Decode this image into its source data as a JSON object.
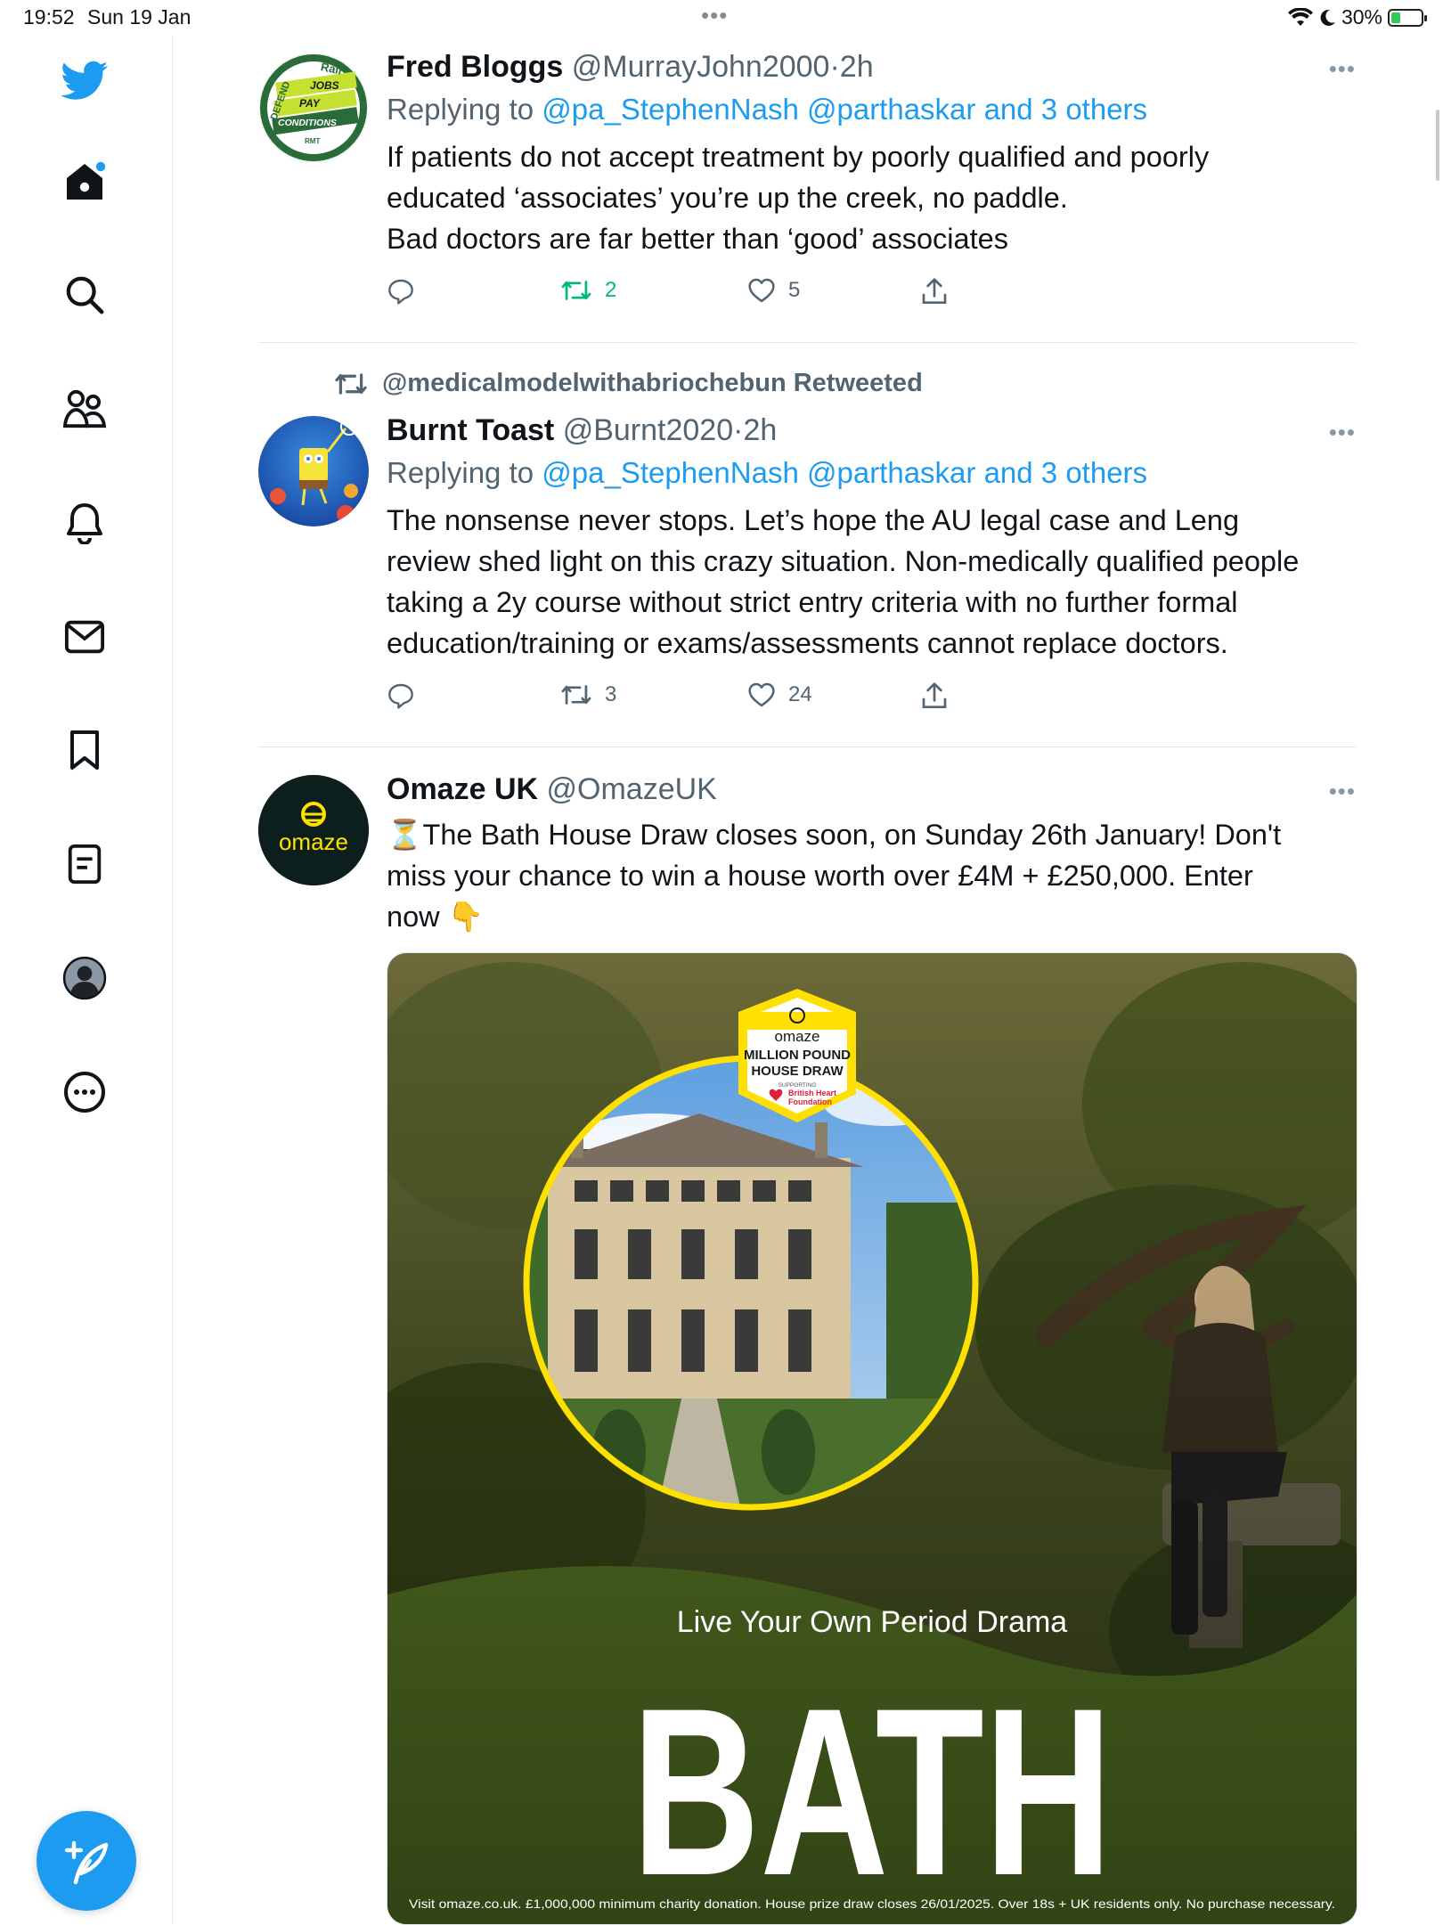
{
  "status_bar": {
    "time": "19:52",
    "date": "Sun 19 Jan",
    "battery": "30%",
    "battery_level": 0.3
  },
  "sidebar": {
    "items": [
      {
        "name": "twitter-logo-icon"
      },
      {
        "name": "home-icon"
      },
      {
        "name": "search-icon"
      },
      {
        "name": "communities-icon"
      },
      {
        "name": "notifications-icon"
      },
      {
        "name": "messages-icon"
      },
      {
        "name": "bookmarks-icon"
      },
      {
        "name": "lists-icon"
      },
      {
        "name": "profile-icon"
      },
      {
        "name": "more-icon"
      }
    ],
    "compose_icon": "compose-icon"
  },
  "tweets": [
    {
      "name": "Fred Bloggs",
      "handle": "@MurrayJohn2000",
      "separator": "·",
      "time": "2h",
      "replying_prefix": "Replying to",
      "replying_mentions": "@pa_StephenNash @parthaskar and 3 others",
      "text_lines": [
        "If patients do not accept treatment by poorly qualified and poorly",
        "educated ‘associates’ you’re up the creek, no paddle.",
        "Bad doctors are far better than ‘good’ associates"
      ],
      "retweets": "2",
      "likes": "5",
      "avatar_text": {
        "top": "DEFEND",
        "rail": "Rail",
        "jobs": "JOBS",
        "pay": "PAY",
        "conditions": "CONDITIONS",
        "rmt": "RMT"
      }
    },
    {
      "retweeted_by": "@medicalmodelwithabriochebun Retweeted",
      "name": "Burnt Toast",
      "handle": "@Burnt2020",
      "separator": "·",
      "time": "2h",
      "replying_prefix": "Replying to",
      "replying_mentions": "@pa_StephenNash @parthaskar and 3 others",
      "text_lines": [
        "The nonsense never stops. Let’s hope the AU legal case and Leng",
        "review shed light on this crazy situation. Non-medically qualified people",
        "taking a 2y course without strict entry criteria with no further formal",
        "education/training or exams/assessments cannot replace doctors."
      ],
      "retweets": "3",
      "likes": "24"
    },
    {
      "name": "Omaze UK",
      "handle": "@OmazeUK",
      "text_lines": [
        "⏳The Bath House Draw closes soon, on Sunday 26th January! Don't",
        "miss your chance to win a house worth over £4M + £250,000. Enter",
        "now 👇"
      ],
      "avatar_label": "omaze",
      "media": {
        "badge_brand": "omaze",
        "badge_title": "MILLION POUND HOUSE DRAW",
        "badge_supporting": "SUPPORTING",
        "badge_charity": "British Heart Foundation",
        "tagline": "Live Your Own Period Drama",
        "headline": "BATH",
        "disclaimer": "Visit omaze.co.uk. £1,000,000 minimum charity donation. House prize draw closes 26/01/2025. Over 18s + UK residents only. No purchase necessary."
      }
    }
  ],
  "colors": {
    "accent": "#1d9bf0",
    "retweet_active": "#00ba7c",
    "secondary": "#536471",
    "omaze_yellow": "#ffe000"
  }
}
